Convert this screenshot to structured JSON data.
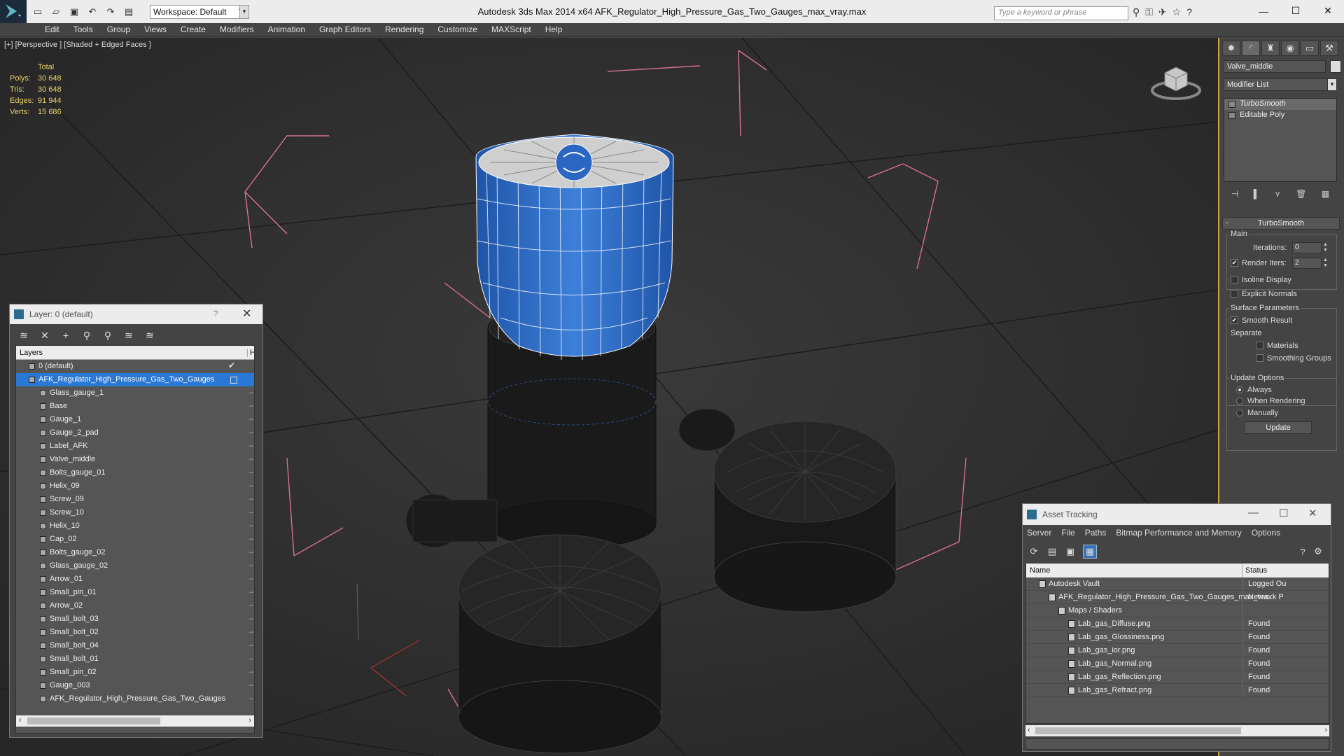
{
  "titlebar": {
    "workspace": "Workspace: Default",
    "app_title": "Autodesk 3ds Max  2014 x64      AFK_Regulator_High_Pressure_Gas_Two_Gauges_max_vray.max",
    "search_placeholder": "Type a keyword or phrase"
  },
  "menu": [
    "Edit",
    "Tools",
    "Group",
    "Views",
    "Create",
    "Modifiers",
    "Animation",
    "Graph Editors",
    "Rendering",
    "Customize",
    "MAXScript",
    "Help"
  ],
  "viewport": {
    "label": "[+] [Perspective ] [Shaded + Edged Faces ]",
    "stats_header": "Total",
    "stats": [
      {
        "k": "Polys:",
        "v": "30 648"
      },
      {
        "k": "Tris:",
        "v": "30 648"
      },
      {
        "k": "Edges:",
        "v": "91 944"
      },
      {
        "k": "Verts:",
        "v": "15 686"
      }
    ]
  },
  "command_panel": {
    "object_name": "Valve_middle",
    "modifier_list": "Modifier List",
    "stack": [
      "TurboSmooth",
      "Editable Poly"
    ],
    "rollout_title": "TurboSmooth",
    "main_group": "Main",
    "iterations_label": "Iterations:",
    "iterations_value": "0",
    "render_iters_label": "Render Iters:",
    "render_iters_value": "2",
    "isoline": "Isoline Display",
    "explicit_normals": "Explicit Normals",
    "surface_params": "Surface Parameters",
    "smooth_result": "Smooth Result",
    "separate": "Separate",
    "materials": "Materials",
    "smoothing_groups": "Smoothing Groups",
    "update_options": "Update Options",
    "always": "Always",
    "when_rendering": "When Rendering",
    "manually": "Manually",
    "update_btn": "Update"
  },
  "layer_dialog": {
    "title": "Layer: 0 (default)",
    "col_layers": "Layers",
    "col_hide": "Hi",
    "default_layer": "0 (default)",
    "main_layer": "AFK_Regulator_High_Pressure_Gas_Two_Gauges",
    "objects": [
      "Glass_gauge_1",
      "Base",
      "Gauge_1",
      "Gauge_2_pad",
      "Label_AFK",
      "Valve_middle",
      "Bolts_gauge_01",
      "Helix_09",
      "Screw_09",
      "Screw_10",
      "Helix_10",
      "Cap_02",
      "Bolts_gauge_02",
      "Glass_gauge_02",
      "Arrow_01",
      "Small_pin_01",
      "Arrow_02",
      "Small_bolt_03",
      "Small_bolt_02",
      "Small_bolt_04",
      "Small_bolt_01",
      "Small_pin_02",
      "Gauge_003",
      "AFK_Regulator_High_Pressure_Gas_Two_Gauges"
    ]
  },
  "asset_dialog": {
    "title": "Asset Tracking",
    "menu": [
      "Server",
      "File",
      "Paths",
      "Bitmap Performance and Memory",
      "Options"
    ],
    "col_name": "Name",
    "col_status": "Status",
    "rows": [
      {
        "name": "Autodesk Vault",
        "status": "Logged Ou",
        "level": 1
      },
      {
        "name": "AFK_Regulator_High_Pressure_Gas_Two_Gauges_max_vra...",
        "status": "Network P",
        "level": 2
      },
      {
        "name": "Maps / Shaders",
        "status": "",
        "level": 3
      },
      {
        "name": "Lab_gas_Diffuse.png",
        "status": "Found",
        "level": 4
      },
      {
        "name": "Lab_gas_Glossiness.png",
        "status": "Found",
        "level": 4
      },
      {
        "name": "Lab_gas_ior.png",
        "status": "Found",
        "level": 4
      },
      {
        "name": "Lab_gas_Normal.png",
        "status": "Found",
        "level": 4
      },
      {
        "name": "Lab_gas_Reflection.png",
        "status": "Found",
        "level": 4
      },
      {
        "name": "Lab_gas_Refract.png",
        "status": "Found",
        "level": 4
      }
    ]
  },
  "colors": {
    "accent": "#2a78d6",
    "stats": "#e9d16b",
    "panel_border": "#c8a640",
    "knob": "#2f6fc9"
  }
}
